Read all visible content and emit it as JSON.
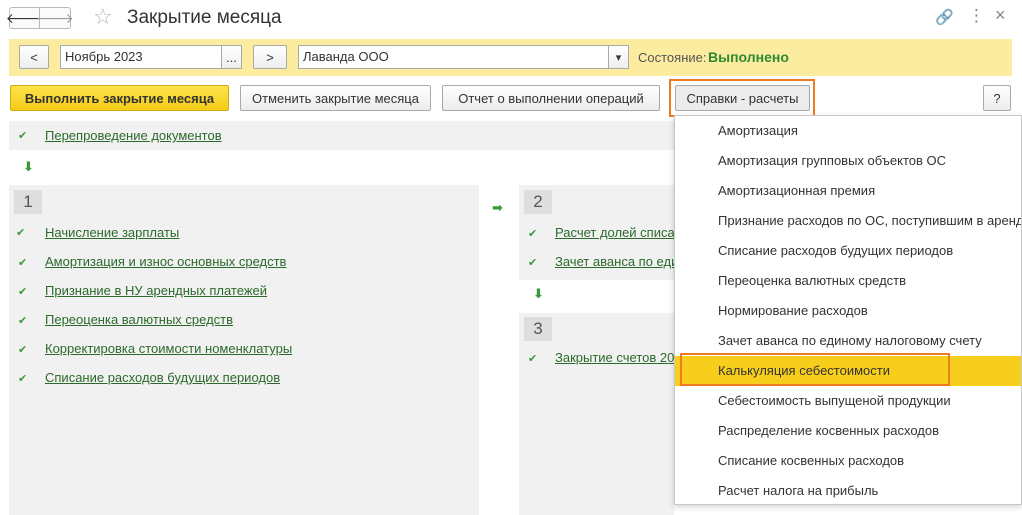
{
  "window": {
    "title": "Закрытие месяца",
    "back_glyph": "🡐",
    "forward_glyph": "🡒",
    "star_glyph": "☆",
    "link_glyph": "🔗",
    "more_glyph": "⋮",
    "close_glyph": "×"
  },
  "period": {
    "prev_label": "<",
    "value": "Ноябрь 2023",
    "select_label": "...",
    "next_label": ">"
  },
  "organization": {
    "value": "Лаванда ООО",
    "dropdown_glyph": "▾"
  },
  "status": {
    "label": "Состояние:",
    "value": "Выполнено"
  },
  "toolbar": {
    "execute_label": "Выполнить закрытие месяца",
    "cancel_label": "Отменить закрытие месяца",
    "report_label": "Отчет о выполнении операций",
    "references_label": "Справки - расчеты",
    "help_label": "?"
  },
  "reposting": {
    "check": "✔",
    "label": "Перепроведение документов",
    "arrow_down": "⬇"
  },
  "step1": {
    "number": "1",
    "items": [
      {
        "check": "✔",
        "label": "Начисление зарплаты"
      },
      {
        "check": "✔",
        "label": "Амортизация и износ основных средств"
      },
      {
        "check": "✔",
        "label": "Признание в НУ арендных платежей"
      },
      {
        "check": "✔",
        "label": "Переоценка валютных средств"
      },
      {
        "check": "✔",
        "label": "Корректировка стоимости номенклатуры"
      },
      {
        "check": "✔",
        "label": "Списание расходов будущих периодов"
      }
    ],
    "arrow_right": "➡"
  },
  "step2": {
    "number": "2",
    "items": [
      {
        "check": "✔",
        "label": "Расчет долей списа"
      },
      {
        "check": "✔",
        "label": "Зачет аванса по еди"
      }
    ],
    "arrow_down": "⬇"
  },
  "step3": {
    "number": "3",
    "items": [
      {
        "check": "✔",
        "label": "Закрытие счетов 20"
      }
    ]
  },
  "references_menu": {
    "items": [
      "Амортизация",
      "Амортизация групповых объектов ОС",
      "Амортизационная премия",
      "Признание расходов по ОС, поступившим в аренду",
      "Списание расходов будущих периодов",
      "Переоценка валютных средств",
      "Нормирование расходов",
      "Зачет аванса по единому налоговому счету",
      "Калькуляция себестоимости",
      "Себестоимость выпущеной продукции",
      "Распределение косвенных расходов",
      "Списание косвенных расходов",
      "Расчет налога на прибыль"
    ],
    "selected_index": 8
  },
  "colors": {
    "accent_yellow": "#f7ce1c",
    "highlight_frame": "#ef7a22",
    "status_green": "#2f8a2f",
    "link_green": "#2b6a2b"
  }
}
